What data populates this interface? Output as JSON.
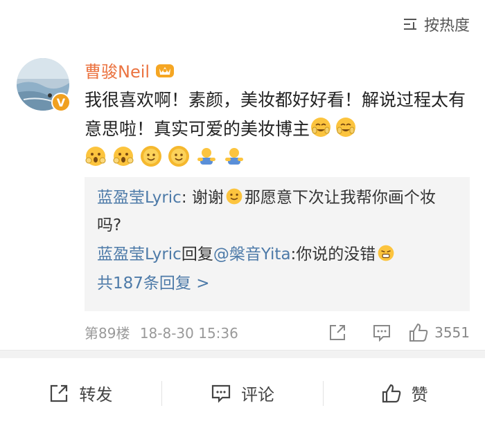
{
  "sort": {
    "label": "按热度"
  },
  "comment": {
    "username": "曹骏Neil",
    "text_part1": "我很喜欢啊！素颜，美妆都好好看！解说过程太有意思啦！真实可爱的美妆博主",
    "floor": "第89楼",
    "datetime": "18-8-30 15:36",
    "like_count": "3551"
  },
  "replies": {
    "reply1_user": "蓝盈莹Lyric",
    "reply1_text_a": ": 谢谢",
    "reply1_text_b": "那愿意下次让我帮你画个妆吗?",
    "reply2_user": "蓝盈莹Lyric",
    "reply2_mid": "回复",
    "reply2_target": "@槃音Yita",
    "reply2_text": ":你说的没错",
    "more": "共187条回复 >"
  },
  "bottom_bar": {
    "repost": "转发",
    "comment": "评论",
    "like": "赞"
  },
  "colors": {
    "username": "#eb7340",
    "link": "#4d7aa8",
    "reply_bg": "#f4f4f4",
    "badge": "#f0a020"
  },
  "icons": [
    "sort-icon",
    "vip-crown-icon",
    "verified-badge",
    "laugh-cry-emoji",
    "shocked-emoji",
    "flower-smile-emoji",
    "hug-emoji",
    "smile-emoji",
    "grimace-emoji",
    "share-icon",
    "comment-icon",
    "thumbs-up-icon"
  ]
}
